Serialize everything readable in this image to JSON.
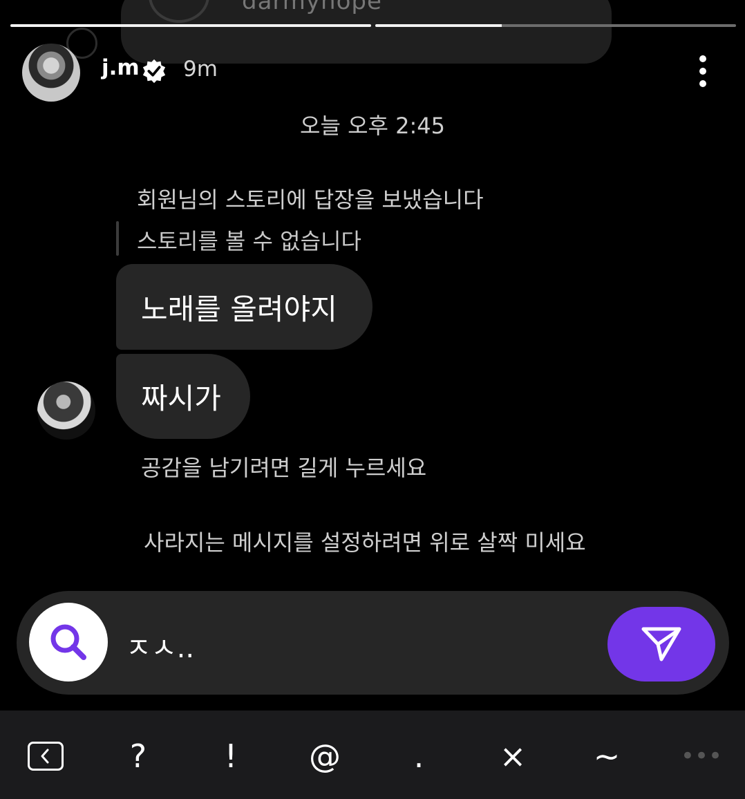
{
  "top_remnant": {
    "username": "darmyhope"
  },
  "story": {
    "progress": [
      1.0,
      0.35
    ]
  },
  "header": {
    "username": "j.m",
    "verified": true,
    "time_ago": "9m",
    "menu_icon": "more-vertical-icon"
  },
  "chat": {
    "timestamp": "오늘 오후 2:45",
    "reply_label": "회원님의 스토리에 답장을 보냈습니다",
    "reply_unavailable": "스토리를 볼 수 없습니다",
    "messages": [
      {
        "text": "노래를 올려야지"
      },
      {
        "text": "짜시가"
      }
    ],
    "hint_like": "공감을 남기려면 길게 누르세요",
    "hint_vanish": "사라지는 메시지를 설정하려면 위로 살짝 미세요"
  },
  "composer": {
    "value": "ㅈㅅ..",
    "search_icon": "search-icon",
    "send_icon": "send-icon",
    "accent_color": "#7336e8"
  },
  "keyboard": {
    "keys": [
      "?",
      "!",
      "@",
      ".",
      "×",
      "~",
      "•••"
    ]
  }
}
